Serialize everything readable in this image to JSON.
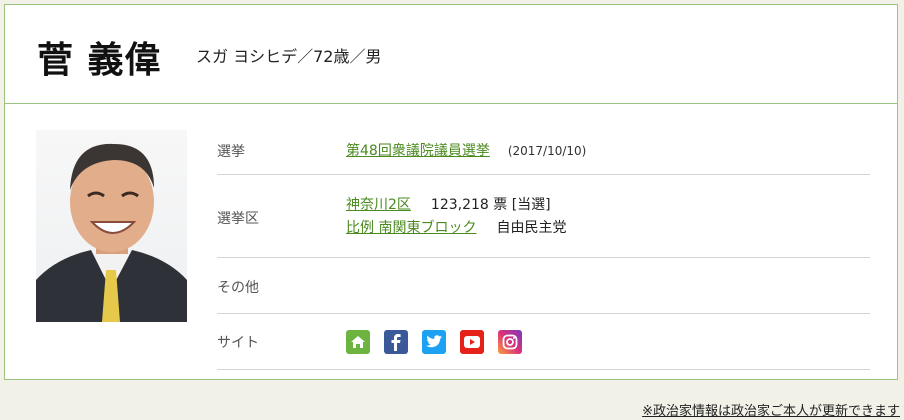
{
  "profile": {
    "name": "菅 義偉",
    "reading": "スガ ヨシヒデ／72歳／男"
  },
  "details": {
    "election": {
      "label": "選挙",
      "link": "第48回衆議院議員選挙",
      "date": "(2017/10/10)"
    },
    "district": {
      "label": "選挙区",
      "district_link": "神奈川2区",
      "votes": "123,218 票 [当選]",
      "pr_link": "比例 南関東ブロック",
      "party": "自由民主党"
    },
    "other": {
      "label": "その他"
    },
    "site": {
      "label": "サイト",
      "icons": [
        "home-icon",
        "facebook-icon",
        "twitter-icon",
        "youtube-icon",
        "instagram-icon"
      ]
    }
  },
  "footer": {
    "note": "※政治家情報は政治家ご本人が更新できます"
  },
  "colors": {
    "border": "#9bc47e",
    "link": "#4a8a1f",
    "home": "#6cb33f",
    "facebook": "#3b5998",
    "twitter": "#1da1f2",
    "youtube": "#e62117",
    "instagram": "#c13584"
  }
}
